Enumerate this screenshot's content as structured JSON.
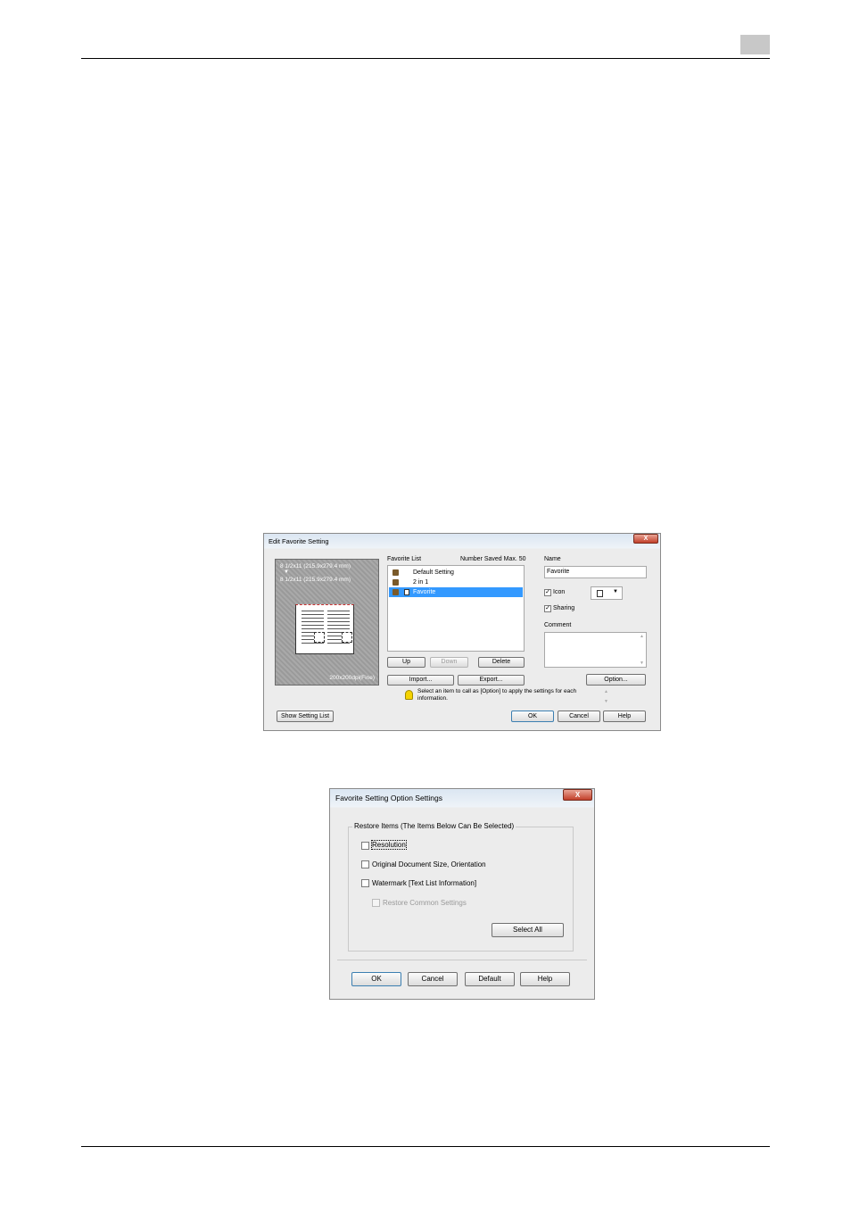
{
  "dialog1": {
    "title": "Edit Favorite Setting",
    "close_symbol": "X",
    "preview": {
      "size_line1": "8 1/2x11 (215.9x279.4 mm)",
      "arrow": "▼",
      "size_line2": "8 1/2x11 (215.9x279.4 mm)",
      "resolution": "200x200dpi(Fine)"
    },
    "favorite_list_label": "Favorite List",
    "number_saved": "Number Saved Max. 50",
    "items": [
      {
        "label": "Default Setting"
      },
      {
        "label": "2 in 1"
      },
      {
        "label": "Favorite"
      }
    ],
    "buttons": {
      "up": "Up",
      "down": "Down",
      "delete": "Delete",
      "import": "Import...",
      "export": "Export...",
      "option": "Option...",
      "show_setting_list": "Show Setting List",
      "ok": "OK",
      "cancel": "Cancel",
      "help": "Help"
    },
    "name_label": "Name",
    "name_value": "Favorite",
    "icon_label": "Icon",
    "icon_checked": true,
    "sharing_label": "Sharing",
    "sharing_checked": true,
    "comment_label": "Comment",
    "comment_value": "",
    "hint": "Select an item to call as [Option] to apply the settings for each information."
  },
  "dialog2": {
    "title": "Favorite Setting Option Settings",
    "close_symbol": "X",
    "group_label": "Restore Items (The Items Below Can Be Selected)",
    "options": [
      {
        "label": "Resolution",
        "checked": false,
        "enabled": true
      },
      {
        "label": "Original Document Size, Orientation",
        "checked": false,
        "enabled": true
      },
      {
        "label": "Watermark [Text List Information]",
        "checked": false,
        "enabled": true
      },
      {
        "label": "Restore Common Settings",
        "checked": false,
        "enabled": false
      }
    ],
    "buttons": {
      "select_all": "Select All",
      "ok": "OK",
      "cancel": "Cancel",
      "default": "Default",
      "help": "Help"
    }
  },
  "colors": {
    "chapter_box": "#c8c8c8",
    "selection": "#3399ff",
    "close_button": "#c2402b"
  }
}
